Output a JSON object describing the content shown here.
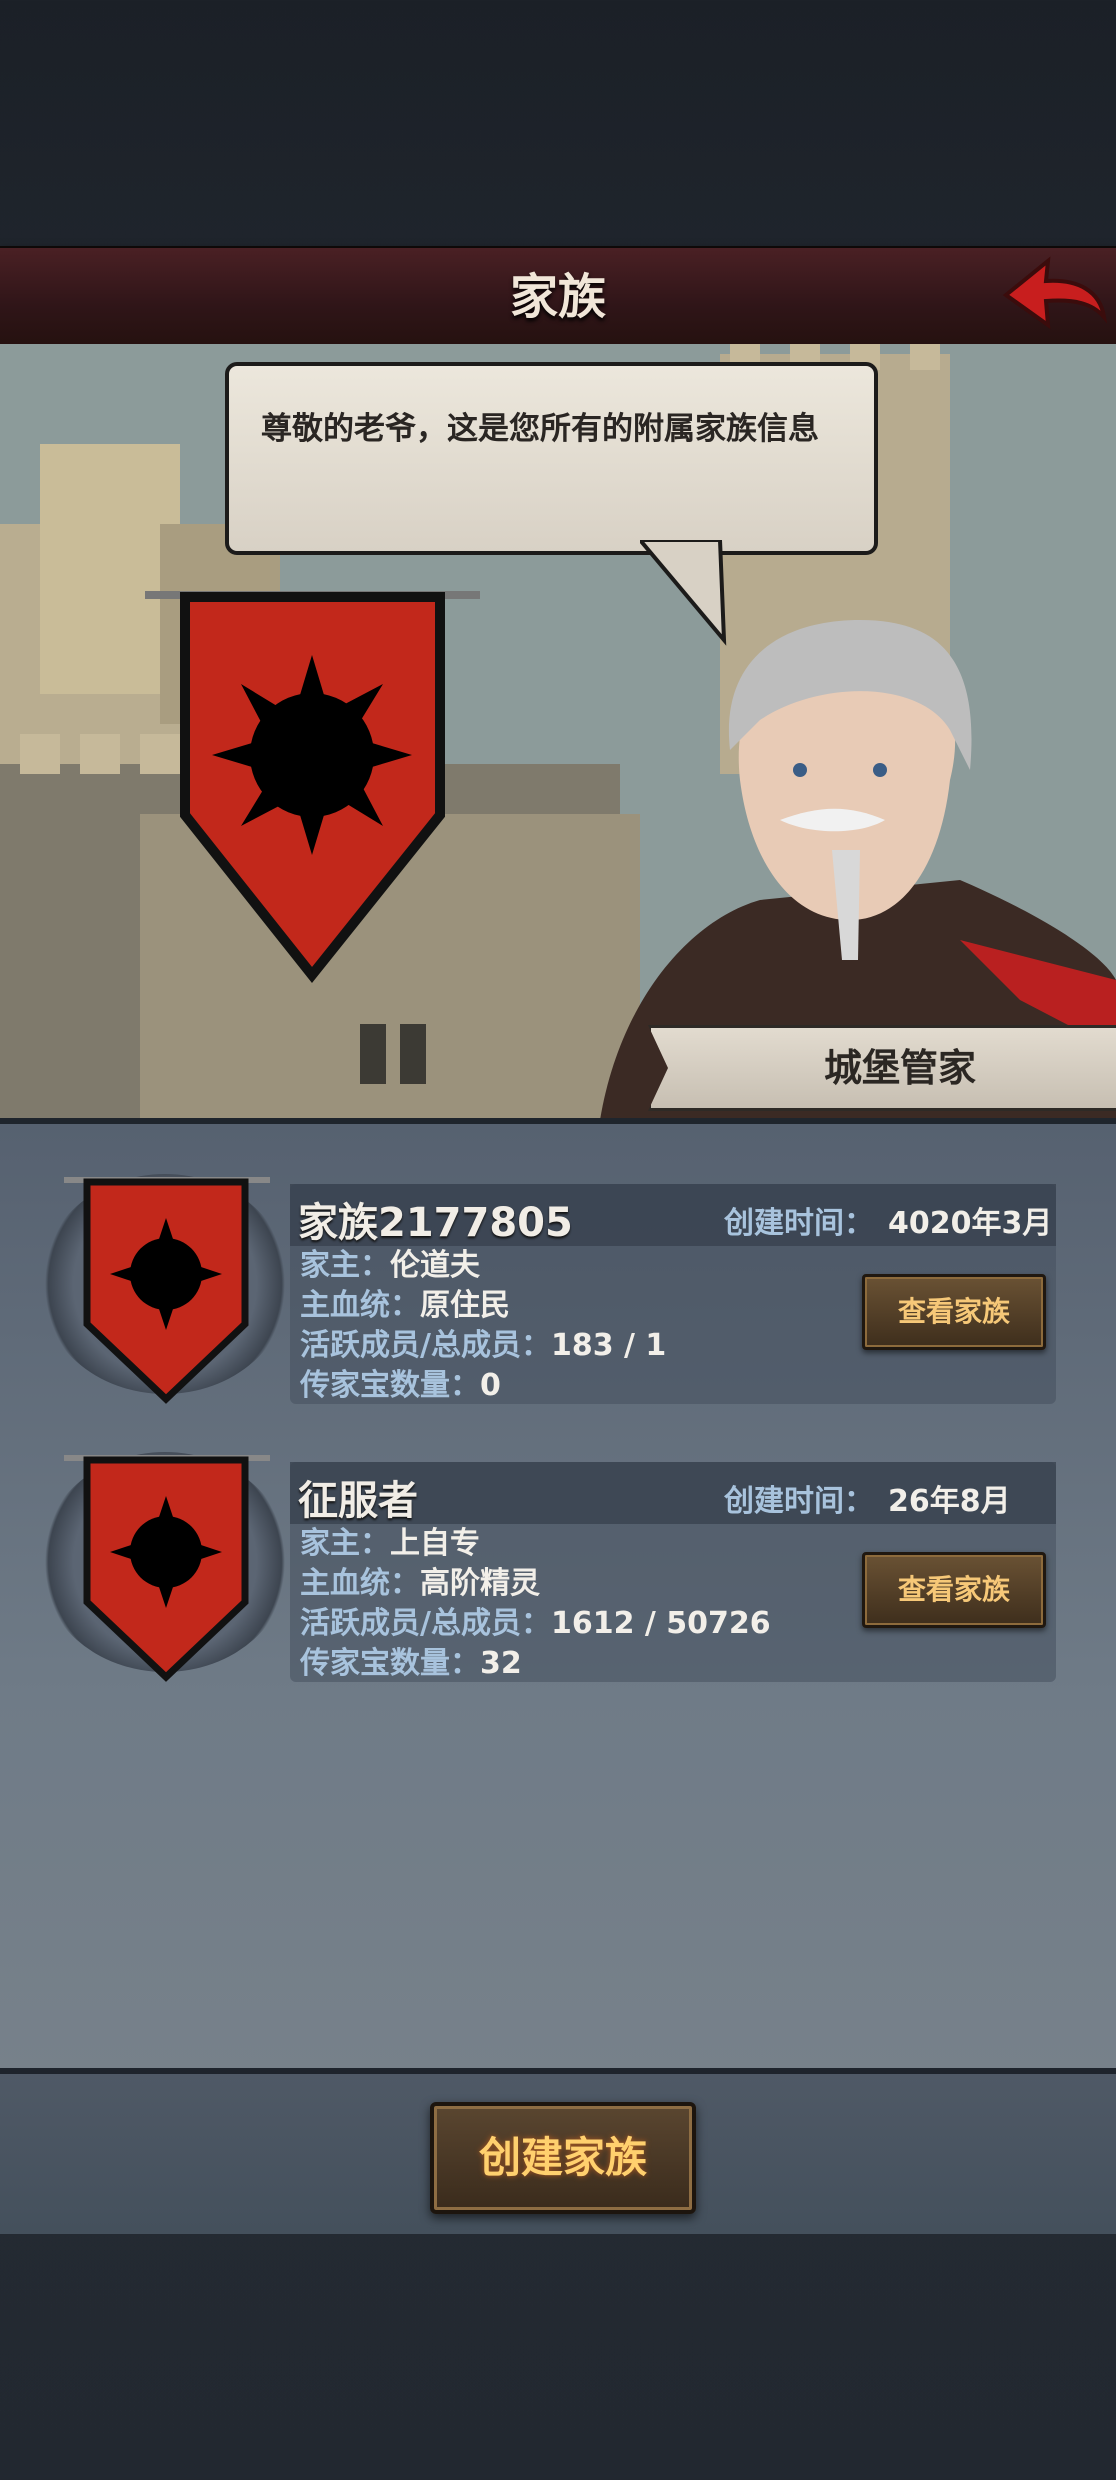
{
  "header": {
    "title": "家族"
  },
  "scene": {
    "speech_text": "尊敬的老爷，这是您所有的附属家族信息",
    "steward_name": "城堡管家"
  },
  "families": [
    {
      "name": "家族2177805",
      "created_label": "创建时间：",
      "created_value": "4020年3月",
      "head_label": "家主：",
      "head_value": "伦道夫",
      "bloodline_label": "主血统：",
      "bloodline_value": "原住民",
      "members_label": "活跃成员/总成员：",
      "members_value": "183 / 1",
      "heirloom_label": "传家宝数量：",
      "heirloom_value": "0",
      "view_button": "查看家族"
    },
    {
      "name": "征服者",
      "created_label": "创建时间：",
      "created_value": "26年8月",
      "head_label": "家主：",
      "head_value": "上自专",
      "bloodline_label": "主血统：",
      "bloodline_value": "高阶精灵",
      "members_label": "活跃成员/总成员：",
      "members_value": "1612 / 50726",
      "heirloom_label": "传家宝数量：",
      "heirloom_value": "32",
      "view_button": "查看家族"
    }
  ],
  "footer": {
    "create_button": "创建家族"
  },
  "colors": {
    "banner_red": "#c2281b",
    "label_blue": "#a8c3dd",
    "button_gold": "#f6c878"
  },
  "icons": {
    "back": "red-back-arrow-icon",
    "emblem": "sun-crest-banner-icon"
  }
}
